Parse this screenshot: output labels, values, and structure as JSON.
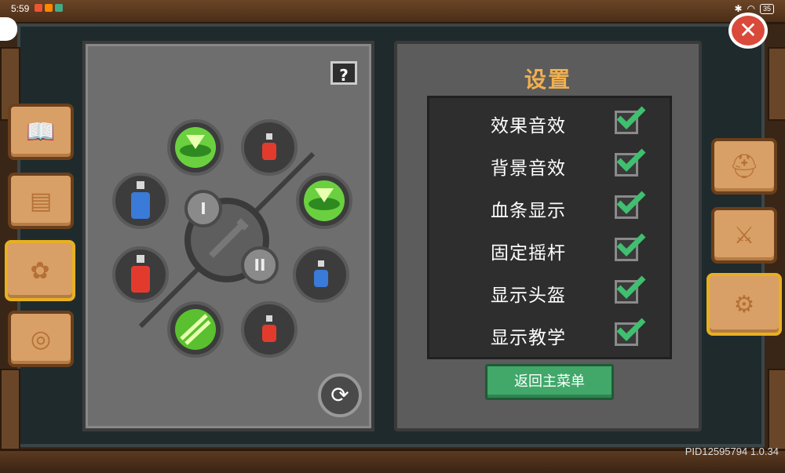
{
  "status_bar": {
    "time": "5:59",
    "battery": "35"
  },
  "settings": {
    "title": "设置",
    "options": [
      {
        "label": "效果音效",
        "checked": true
      },
      {
        "label": "背景音效",
        "checked": true
      },
      {
        "label": "血条显示",
        "checked": true
      },
      {
        "label": "固定摇杆",
        "checked": true
      },
      {
        "label": "显示头盔",
        "checked": true
      },
      {
        "label": "显示教学",
        "checked": true
      }
    ],
    "back_button": "返回主菜单"
  },
  "quick_slots": {
    "help_label": "?",
    "slot_markers": [
      "I",
      "II"
    ],
    "items": [
      "green-portal-skill",
      "red-potion-small",
      "blue-potion",
      "green-portal-skill",
      "red-potion-large",
      "blue-potion-small",
      "green-slash-skill",
      "red-potion-small"
    ]
  },
  "left_tabs": [
    "book-icon",
    "map-icon",
    "gear-cluster-icon",
    "steering-icon"
  ],
  "right_tabs": [
    "helmet-icon",
    "swords-icon",
    "settings-gear-icon"
  ],
  "version": "PID12595794 1.0.34",
  "colors": {
    "accent": "#f0b050",
    "button": "#41a86a",
    "check": "#3fbf6f",
    "close": "#d94a3a"
  }
}
